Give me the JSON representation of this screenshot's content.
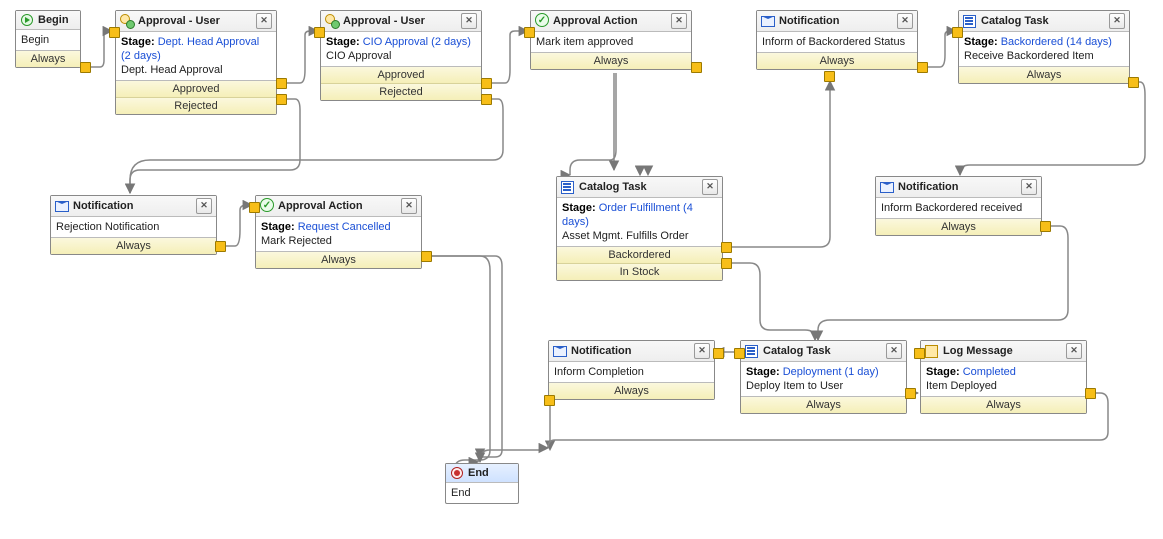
{
  "labels": {
    "stage": "Stage:",
    "close": "✕"
  },
  "nodes": {
    "begin": {
      "title": "Begin",
      "subtitle": "Begin",
      "outcomes": [
        "Always"
      ]
    },
    "approval_dept": {
      "title": "Approval - User",
      "stage": "Dept. Head Approval (2 days)",
      "subtitle": "Dept. Head Approval",
      "outcomes": [
        "Approved",
        "Rejected"
      ]
    },
    "approval_cio": {
      "title": "Approval - User",
      "stage": "CIO Approval (2 days)",
      "subtitle": "CIO Approval",
      "outcomes": [
        "Approved",
        "Rejected"
      ]
    },
    "approval_action_mark": {
      "title": "Approval Action",
      "subtitle": "Mark item approved",
      "outcomes": [
        "Always"
      ]
    },
    "notification_backordered_status": {
      "title": "Notification",
      "subtitle": "Inform of Backordered Status",
      "outcomes": [
        "Always"
      ]
    },
    "catalog_backordered": {
      "title": "Catalog Task",
      "stage": "Backordered (14 days)",
      "subtitle": "Receive Backordered Item",
      "outcomes": [
        "Always"
      ]
    },
    "notification_rejection": {
      "title": "Notification",
      "subtitle": "Rejection Notification",
      "outcomes": [
        "Always"
      ]
    },
    "approval_action_cancelled": {
      "title": "Approval Action",
      "stage": "Request Cancelled",
      "subtitle": "Mark Rejected",
      "outcomes": [
        "Always"
      ]
    },
    "catalog_fulfill": {
      "title": "Catalog Task",
      "stage": "Order Fulfillment (4 days)",
      "subtitle": "Asset Mgmt. Fulfills Order",
      "outcomes": [
        "Backordered",
        "In Stock"
      ]
    },
    "notification_backordered_received": {
      "title": "Notification",
      "subtitle": "Inform Backordered received",
      "outcomes": [
        "Always"
      ]
    },
    "notification_completion": {
      "title": "Notification",
      "subtitle": "Inform Completion",
      "outcomes": [
        "Always"
      ]
    },
    "catalog_deploy": {
      "title": "Catalog Task",
      "stage": "Deployment (1 day)",
      "subtitle": "Deploy Item to User",
      "outcomes": [
        "Always"
      ]
    },
    "log_deployed": {
      "title": "Log Message",
      "stage": "Completed",
      "subtitle": "Item Deployed",
      "outcomes": [
        "Always"
      ]
    },
    "end": {
      "title": "End",
      "subtitle": "End"
    }
  }
}
